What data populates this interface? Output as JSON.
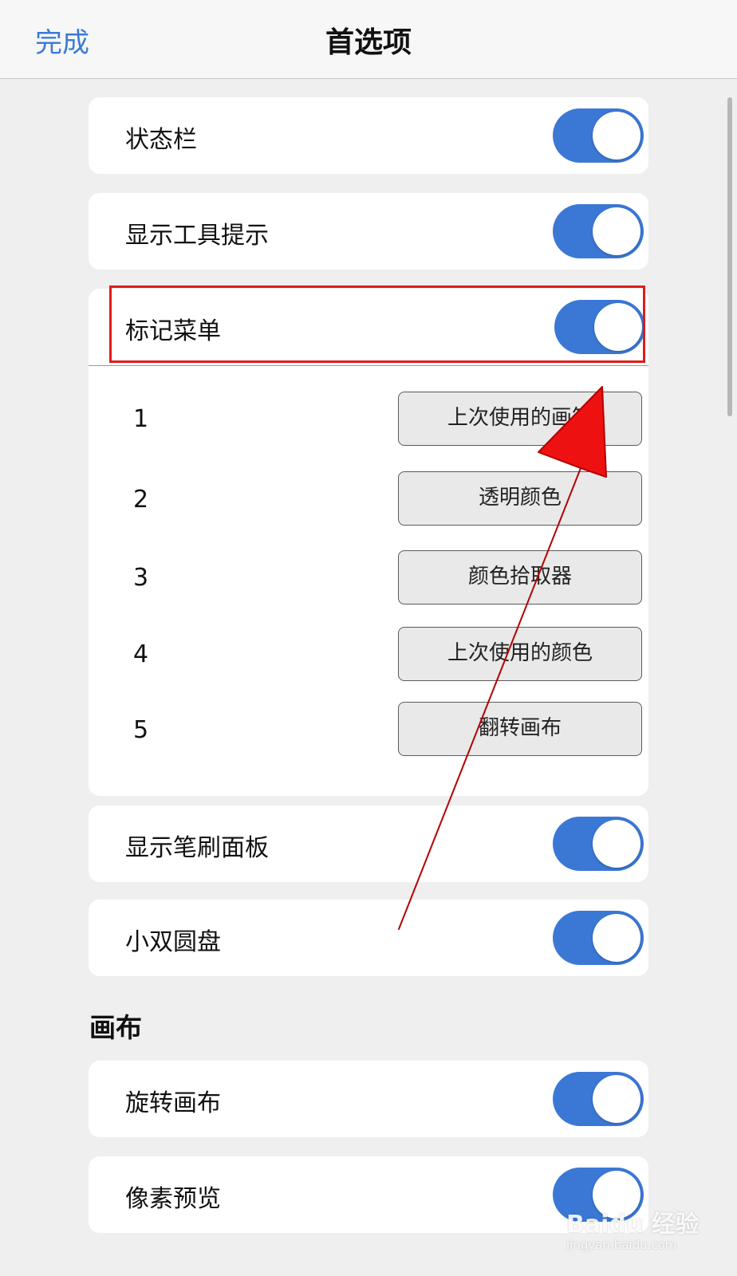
{
  "nav": {
    "done_label": "完成",
    "title": "首选项"
  },
  "settings": [
    {
      "label": "状态栏",
      "on": true
    },
    {
      "label": "显示工具提示",
      "on": true
    },
    {
      "label": "标记菜单",
      "on": true
    },
    {
      "label": "显示笔刷面板",
      "on": true
    },
    {
      "label": "小双圆盘",
      "on": true
    }
  ],
  "marking_menu_slots": [
    {
      "number": "1",
      "value": "上次使用的画笔"
    },
    {
      "number": "2",
      "value": "透明颜色"
    },
    {
      "number": "3",
      "value": "颜色拾取器"
    },
    {
      "number": "4",
      "value": "上次使用的颜色"
    },
    {
      "number": "5",
      "value": "翻转画布"
    }
  ],
  "canvas_section": {
    "header": "画布",
    "items": [
      {
        "label": "旋转画布",
        "on": true
      },
      {
        "label": "像素预览",
        "on": true
      }
    ]
  },
  "watermark": {
    "main": "Baidu 经验",
    "sub": "jingyan.baidu.com"
  },
  "colors": {
    "accent": "#3b78d6",
    "highlight": "#e01b1b",
    "background": "#efefef"
  }
}
